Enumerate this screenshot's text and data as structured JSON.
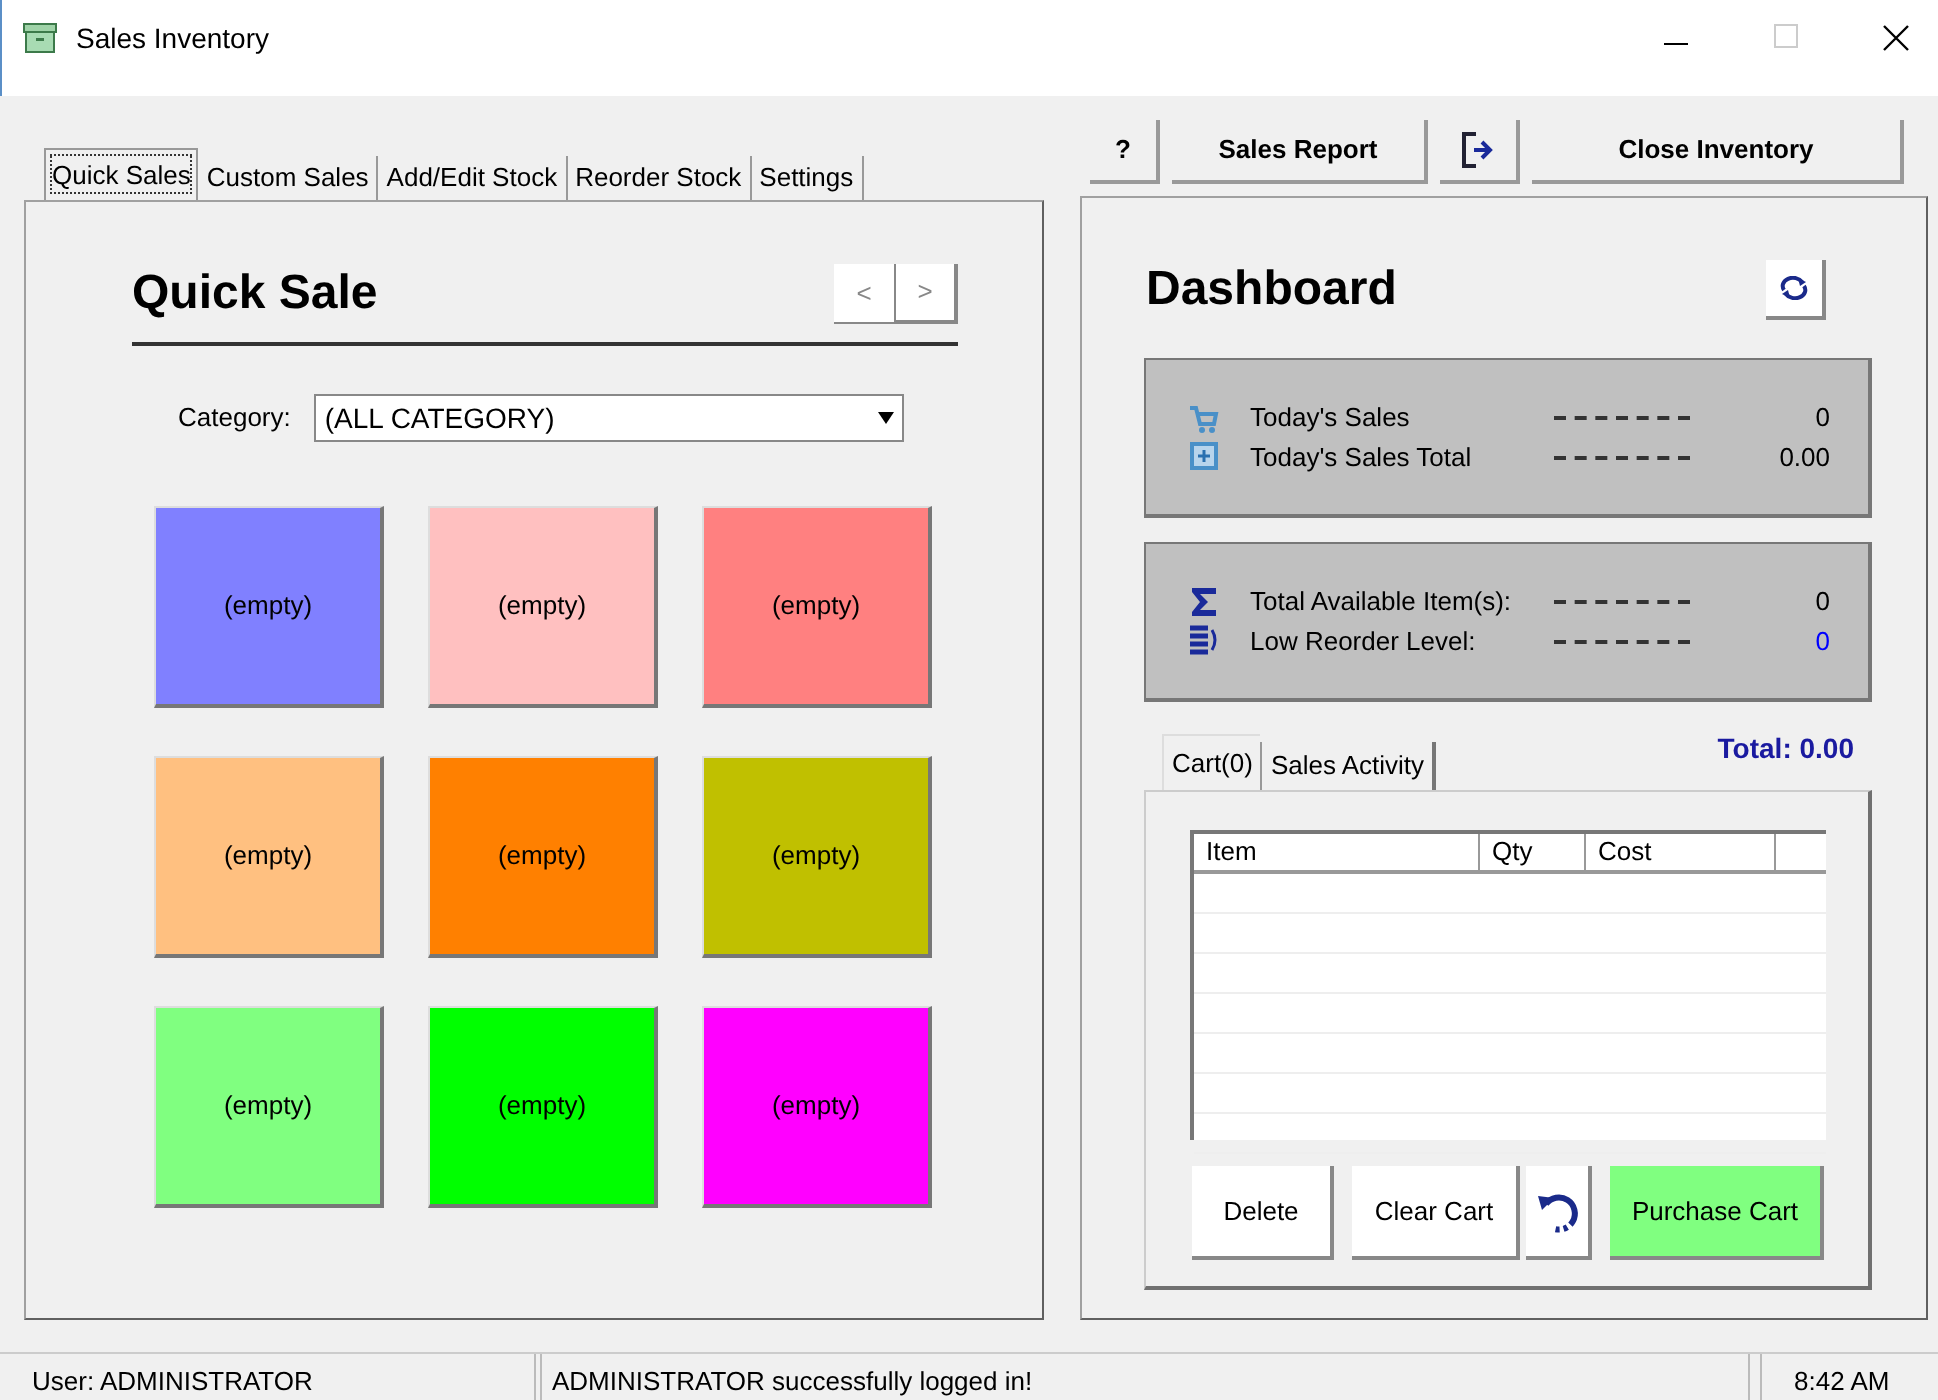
{
  "window": {
    "title": "Sales Inventory"
  },
  "tabs": [
    {
      "label": "Quick Sales",
      "selected": true
    },
    {
      "label": "Custom Sales",
      "selected": false
    },
    {
      "label": "Add/Edit Stock",
      "selected": false
    },
    {
      "label": "Reorder Stock",
      "selected": false
    },
    {
      "label": "Settings",
      "selected": false
    }
  ],
  "toolbar": {
    "help": "?",
    "sales_report": "Sales Report",
    "close_inventory": "Close Inventory"
  },
  "quick_sale": {
    "title": "Quick Sale",
    "prev": "<",
    "next": ">",
    "category_label": "Category:",
    "category_value": "(ALL CATEGORY)",
    "tiles": [
      {
        "label": "(empty)",
        "color": "#8080ff"
      },
      {
        "label": "(empty)",
        "color": "#ffc0c0"
      },
      {
        "label": "(empty)",
        "color": "#ff8080"
      },
      {
        "label": "(empty)",
        "color": "#ffc080"
      },
      {
        "label": "(empty)",
        "color": "#ff8000"
      },
      {
        "label": "(empty)",
        "color": "#c0c000"
      },
      {
        "label": "(empty)",
        "color": "#80ff80"
      },
      {
        "label": "(empty)",
        "color": "#00ff00"
      },
      {
        "label": "(empty)",
        "color": "#ff00ff"
      }
    ]
  },
  "dashboard": {
    "title": "Dashboard",
    "groups": [
      {
        "kind": "sales",
        "stats": [
          {
            "label": "Today's Sales",
            "value": "0",
            "color": "#000000"
          },
          {
            "label": "Today's Sales Total",
            "value": "0.00",
            "color": "#000000"
          }
        ]
      },
      {
        "kind": "stock",
        "stats": [
          {
            "label": "Total Available Item(s):",
            "value": "0",
            "color": "#000000"
          },
          {
            "label": "Low Reorder Level:",
            "value": "0",
            "color": "#0000ff"
          }
        ]
      }
    ],
    "cart_tabs": [
      {
        "label": "Cart(0)",
        "selected": true
      },
      {
        "label": "Sales Activity",
        "selected": false
      }
    ],
    "total": "Total: 0.00",
    "cart_columns": [
      "Item",
      "Qty",
      "Cost"
    ],
    "buttons": {
      "delete": "Delete",
      "clear": "Clear Cart",
      "purchase": "Purchase Cart"
    }
  },
  "status_bar": {
    "user": "User: ADMINISTRATOR",
    "message": "ADMINISTRATOR successfully logged in!",
    "time": "8:42 AM"
  }
}
